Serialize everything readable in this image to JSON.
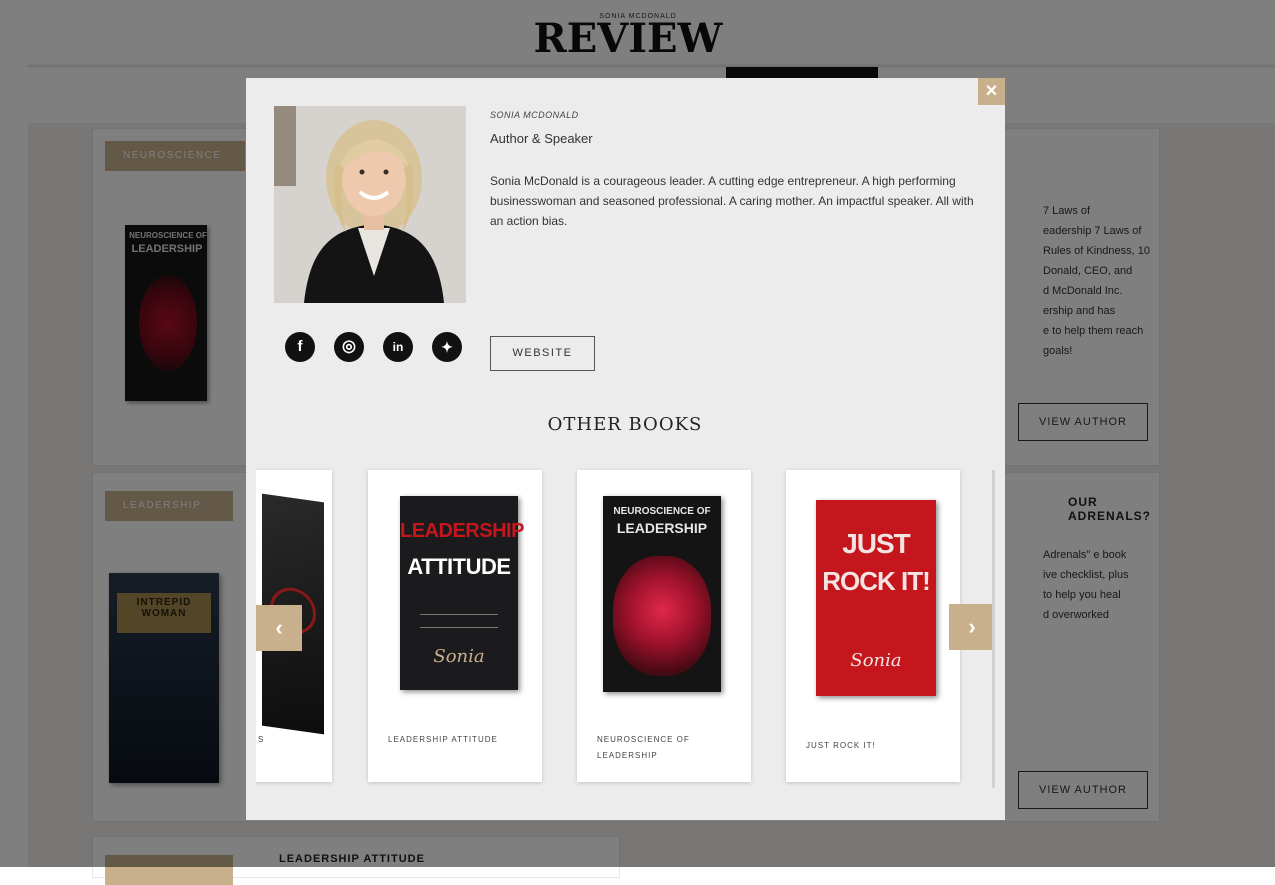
{
  "site": {
    "kicker": "SONIA MCDONALD",
    "title": "REVIEW"
  },
  "background": {
    "card1": {
      "tag": "NEUROSCIENCE",
      "book_title_line1": "NEUROSCIENCE OF",
      "book_title_line2": "LEADERSHIP",
      "side_text": [
        "7 Laws of",
        "eadership 7 Laws of",
        "Rules of Kindness, 10",
        "Donald, CEO, and",
        "d McDonald Inc.",
        "ership and has",
        "e to help them reach",
        "goals!"
      ],
      "button": "VIEW AUTHOR"
    },
    "card2": {
      "tag": "LEADERSHIP",
      "book_title_line1": "INTREPID",
      "book_title_line2": "WOMAN",
      "heading": "OUR ADRENALS?",
      "side_text": [
        "Adrenals\" e book",
        "ive checklist, plus",
        "to help you heal",
        "d overworked"
      ],
      "button": "VIEW AUTHOR"
    },
    "card3": {
      "heading": "LEADERSHIP ATTITUDE"
    }
  },
  "modal": {
    "close_label": "×",
    "author_name": "SONIA MCDONALD",
    "author_role": "Author & Speaker",
    "author_bio": "Sonia McDonald is a courageous leader. A cutting edge entrepreneur. A high performing businesswoman and seasoned professional. A caring mother. An impactful speaker. All with an action bias.",
    "social": [
      {
        "icon": "facebook-icon",
        "glyph": "f"
      },
      {
        "icon": "instagram-icon",
        "glyph": "◎"
      },
      {
        "icon": "linkedin-icon",
        "glyph": "in"
      },
      {
        "icon": "twitter-icon",
        "glyph": "✦"
      }
    ],
    "website_label": "WEBSITE",
    "other_books_title": "OTHER BOOKS",
    "prev_label": "‹",
    "next_label": "›",
    "books": [
      {
        "label": "S",
        "cover_color": "#1a1a1a"
      },
      {
        "label": "LEADERSHIP ATTITUDE",
        "cover_title_1": "LEADERSHIP",
        "cover_title_2": "ATTITUDE",
        "cover_sig": "Sonia",
        "cover_color": "#1b1b1e"
      },
      {
        "label": "NEUROSCIENCE OF LEADERSHIP",
        "cover_title_1": "NEUROSCIENCE OF",
        "cover_title_2": "LEADERSHIP",
        "cover_color": "#141414"
      },
      {
        "label": "JUST ROCK IT!",
        "cover_title_1": "JUST",
        "cover_title_2": "ROCK IT!",
        "cover_sig": "Sonia",
        "cover_color": "#c4161c"
      }
    ]
  },
  "colors": {
    "accent": "#c9b08d",
    "overlay": "rgba(0,0,0,0.5)",
    "modal_bg": "#ececec"
  }
}
